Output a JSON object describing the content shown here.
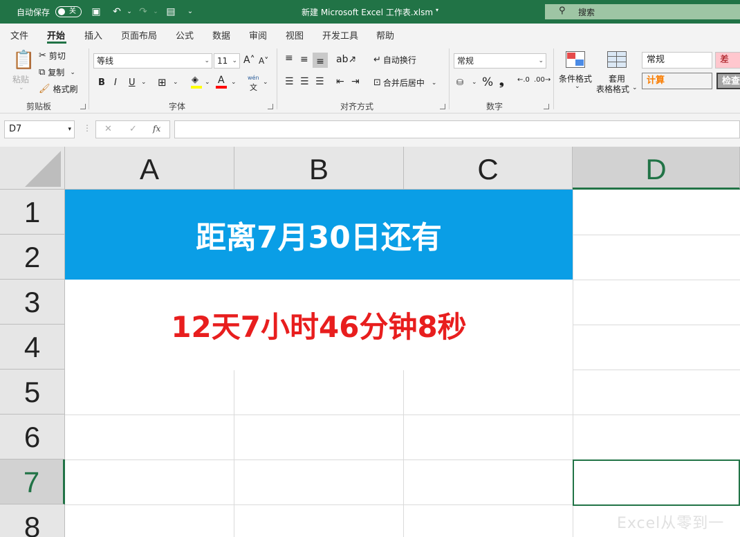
{
  "titlebar": {
    "autosave_label": "自动保存",
    "autosave_state": "关",
    "doc_title": "新建 Microsoft Excel 工作表.xlsm",
    "search_label": "搜索"
  },
  "menu": {
    "tabs": [
      "文件",
      "开始",
      "插入",
      "页面布局",
      "公式",
      "数据",
      "审阅",
      "视图",
      "开发工具",
      "帮助"
    ],
    "active_index": 1
  },
  "ribbon": {
    "clipboard": {
      "paste": "粘贴",
      "cut": "剪切",
      "copy": "复制",
      "format_painter": "格式刷",
      "label": "剪贴板"
    },
    "font": {
      "name": "等线",
      "size": "11",
      "bold": "B",
      "italic": "I",
      "underline": "U",
      "grow": "A˄",
      "shrink": "A˅",
      "wen": "wén",
      "label": "字体"
    },
    "alignment": {
      "wrap": "自动换行",
      "merge": "合并后居中",
      "label": "对齐方式"
    },
    "number": {
      "format": "常规",
      "percent": "%",
      "comma": "❟",
      "label": "数字"
    },
    "styles": {
      "conditional": "条件格式",
      "table_1": "套用",
      "table_2": "表格格式",
      "normal": "常规",
      "bad": "差",
      "calc": "计算",
      "check": "检查"
    }
  },
  "formulabar": {
    "namebox": "D7",
    "fx": "fx",
    "cancel": "✕",
    "enter": "✓",
    "value": ""
  },
  "grid": {
    "columns": [
      "A",
      "B",
      "C",
      "D"
    ],
    "rows": [
      "1",
      "2",
      "3",
      "4",
      "5",
      "6",
      "7",
      "8"
    ],
    "selected_column": "D",
    "selected_row": "7",
    "title_text": "距离7月30日还有",
    "countdown_text": "12天7小时46分钟8秒",
    "title_bg": "#0a9ee6",
    "countdown_color": "#e81e1e"
  },
  "watermark": "Excel从零到一"
}
